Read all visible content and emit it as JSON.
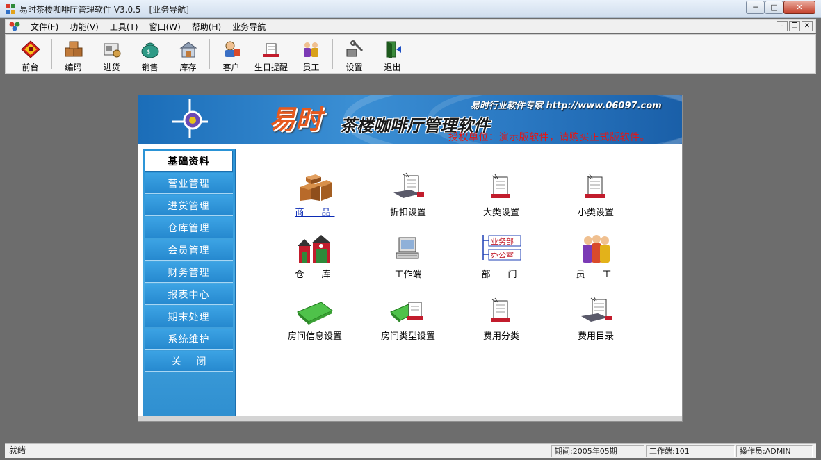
{
  "window": {
    "title": "易时茶楼咖啡厅管理软件 V3.0.5 - [业务导航]",
    "minimize": "─",
    "maximize": "□",
    "close": "✕"
  },
  "menu": {
    "items": [
      "文件(F)",
      "功能(V)",
      "工具(T)",
      "窗口(W)",
      "帮助(H)",
      "业务导航"
    ]
  },
  "toolbar": {
    "buttons": [
      "前台",
      "编码",
      "进货",
      "销售",
      "库存",
      "客户",
      "生日提醒",
      "员工",
      "设置",
      "退出"
    ]
  },
  "banner": {
    "brand_big": "易时",
    "brand_sub": "茶楼咖啡厅管理软件",
    "expert": "易时行业软件专家 http://www.06097.com",
    "license": "授权单位：演示版软件，请购买正式版软件。"
  },
  "sidebar": {
    "items": [
      "基础资料",
      "营业管理",
      "进货管理",
      "仓库管理",
      "会员管理",
      "财务管理",
      "报表中心",
      "期末处理",
      "系统维护",
      "关闭"
    ]
  },
  "tiles": {
    "items": [
      "商　品",
      "折扣设置",
      "大类设置",
      "小类设置",
      "仓　库",
      "工作端",
      "部　门",
      "员　工",
      "房间信息设置",
      "房间类型设置",
      "费用分类",
      "费用目录"
    ],
    "dept_labels": [
      "业务部",
      "办公室"
    ]
  },
  "status": {
    "ready": "就绪",
    "period": "期间:2005年05期",
    "workstation": "工作端:101",
    "operator": "操作员:ADMIN"
  },
  "colors": {
    "sidebar_blue": "#2a93d6",
    "license_red": "#e01818",
    "brand_orange": "#e65a1f",
    "link_blue": "#0b2bb5"
  }
}
